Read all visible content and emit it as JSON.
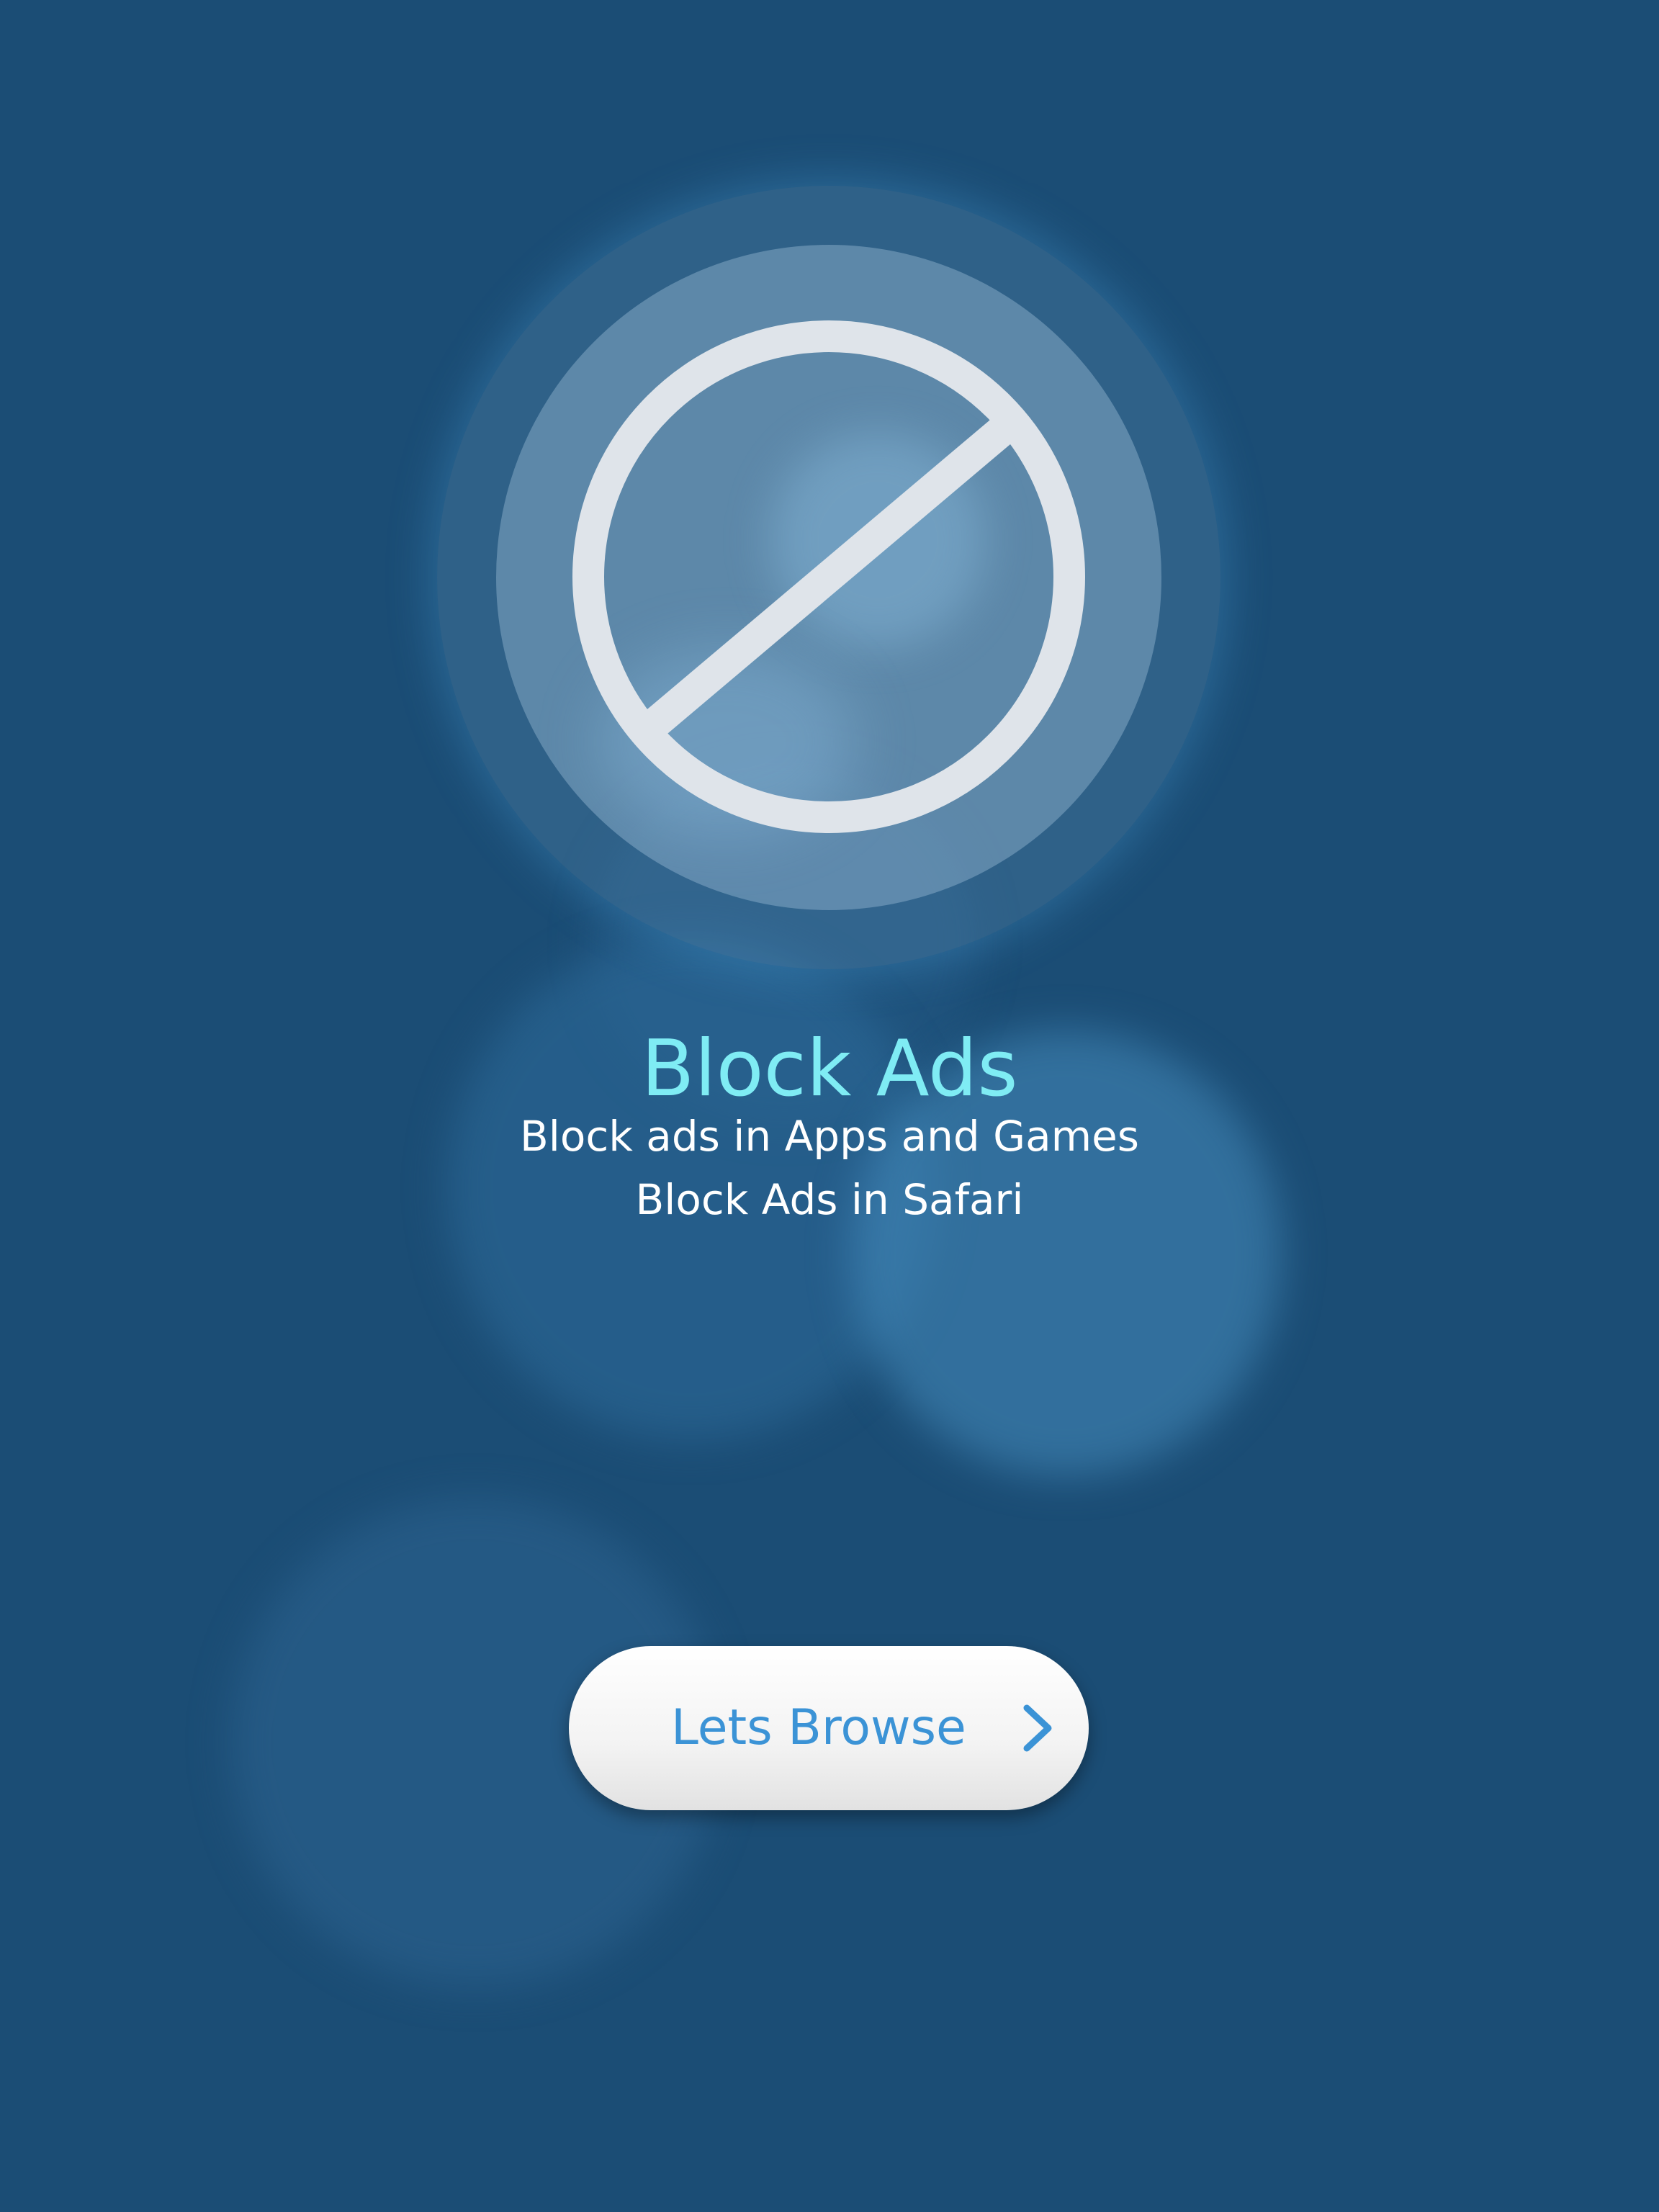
{
  "colors": {
    "background": "#1b4d75",
    "title": "#7fecf4",
    "subtitle": "#ffffff",
    "button_background": "#ffffff",
    "button_text": "#3b93d6",
    "icon_stroke": "#dfe4ea"
  },
  "hero": {
    "icon": "block-icon",
    "title": "Block Ads",
    "features": [
      "Block ads in Apps and Games",
      "Block Ads in Safari"
    ]
  },
  "cta": {
    "label": "Lets Browse",
    "icon": "chevron-right-icon"
  }
}
